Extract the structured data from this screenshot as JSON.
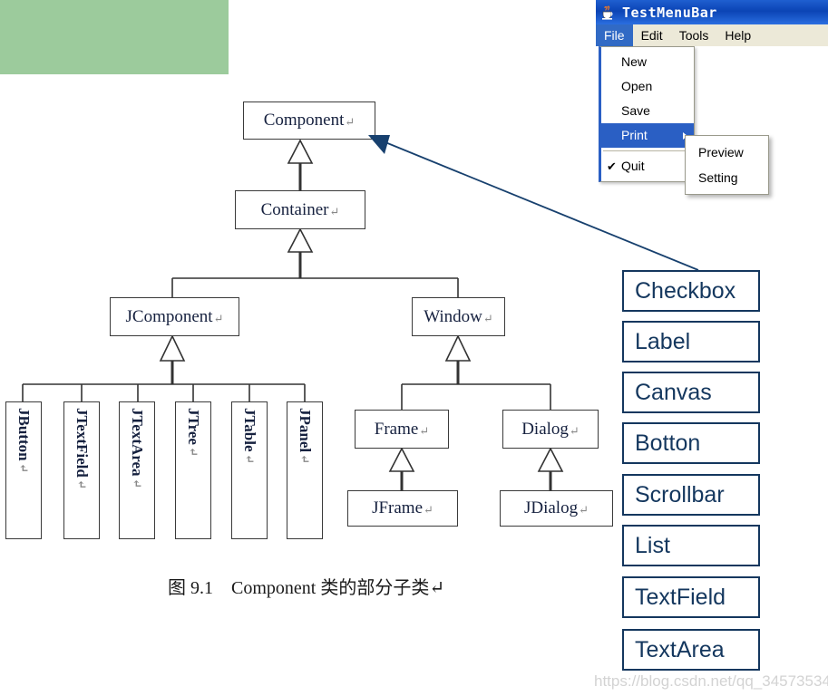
{
  "decorations": {
    "green_block_color": "#9ccb9c",
    "watermark": "https://blog.csdn.net/qq_34573534"
  },
  "diagram": {
    "caption": "图 9.1　Component 类的部分子类",
    "caption_pilcrow": "↵",
    "pilcrow": "↵",
    "nodes": {
      "component": "Component",
      "container": "Container",
      "jcomponent": "JComponent",
      "window": "Window",
      "frame": "Frame",
      "dialog": "Dialog",
      "jframe": "JFrame",
      "jdialog": "JDialog"
    },
    "leaf_nodes": [
      {
        "label": "JButton"
      },
      {
        "label": "JTextField"
      },
      {
        "label": "JTextArea"
      },
      {
        "label": "JTree"
      },
      {
        "label": "JTable"
      },
      {
        "label": "JPanel"
      }
    ],
    "line_color": "#333333",
    "arrow_color": "#17406e"
  },
  "java_window": {
    "title": "TestMenuBar",
    "title_icon": "java-coffee-cup-icon",
    "titlebar_color": "#0b44b5",
    "menubar": [
      {
        "label": "File",
        "active": true
      },
      {
        "label": "Edit",
        "active": false
      },
      {
        "label": "Tools",
        "active": false
      },
      {
        "label": "Help",
        "active": false
      }
    ],
    "file_menu": [
      {
        "label": "New",
        "highlight": false,
        "submenu": false,
        "checked": false
      },
      {
        "label": "Open",
        "highlight": false,
        "submenu": false,
        "checked": false
      },
      {
        "label": "Save",
        "highlight": false,
        "submenu": false,
        "checked": false
      },
      {
        "label": "Print",
        "highlight": true,
        "submenu": true,
        "checked": false
      },
      {
        "label": "Quit",
        "highlight": false,
        "submenu": false,
        "checked": true
      }
    ],
    "print_submenu": [
      {
        "label": "Preview"
      },
      {
        "label": "Setting"
      }
    ],
    "highlight_color": "#2a5fc4",
    "check_glyph": "✔"
  },
  "component_list": {
    "border_color": "#14375e",
    "items": [
      {
        "label": "Checkbox"
      },
      {
        "label": "Label"
      },
      {
        "label": "Canvas"
      },
      {
        "label": "Botton"
      },
      {
        "label": "Scrollbar"
      },
      {
        "label": "List"
      },
      {
        "label": "TextField"
      },
      {
        "label": "TextArea"
      }
    ]
  }
}
